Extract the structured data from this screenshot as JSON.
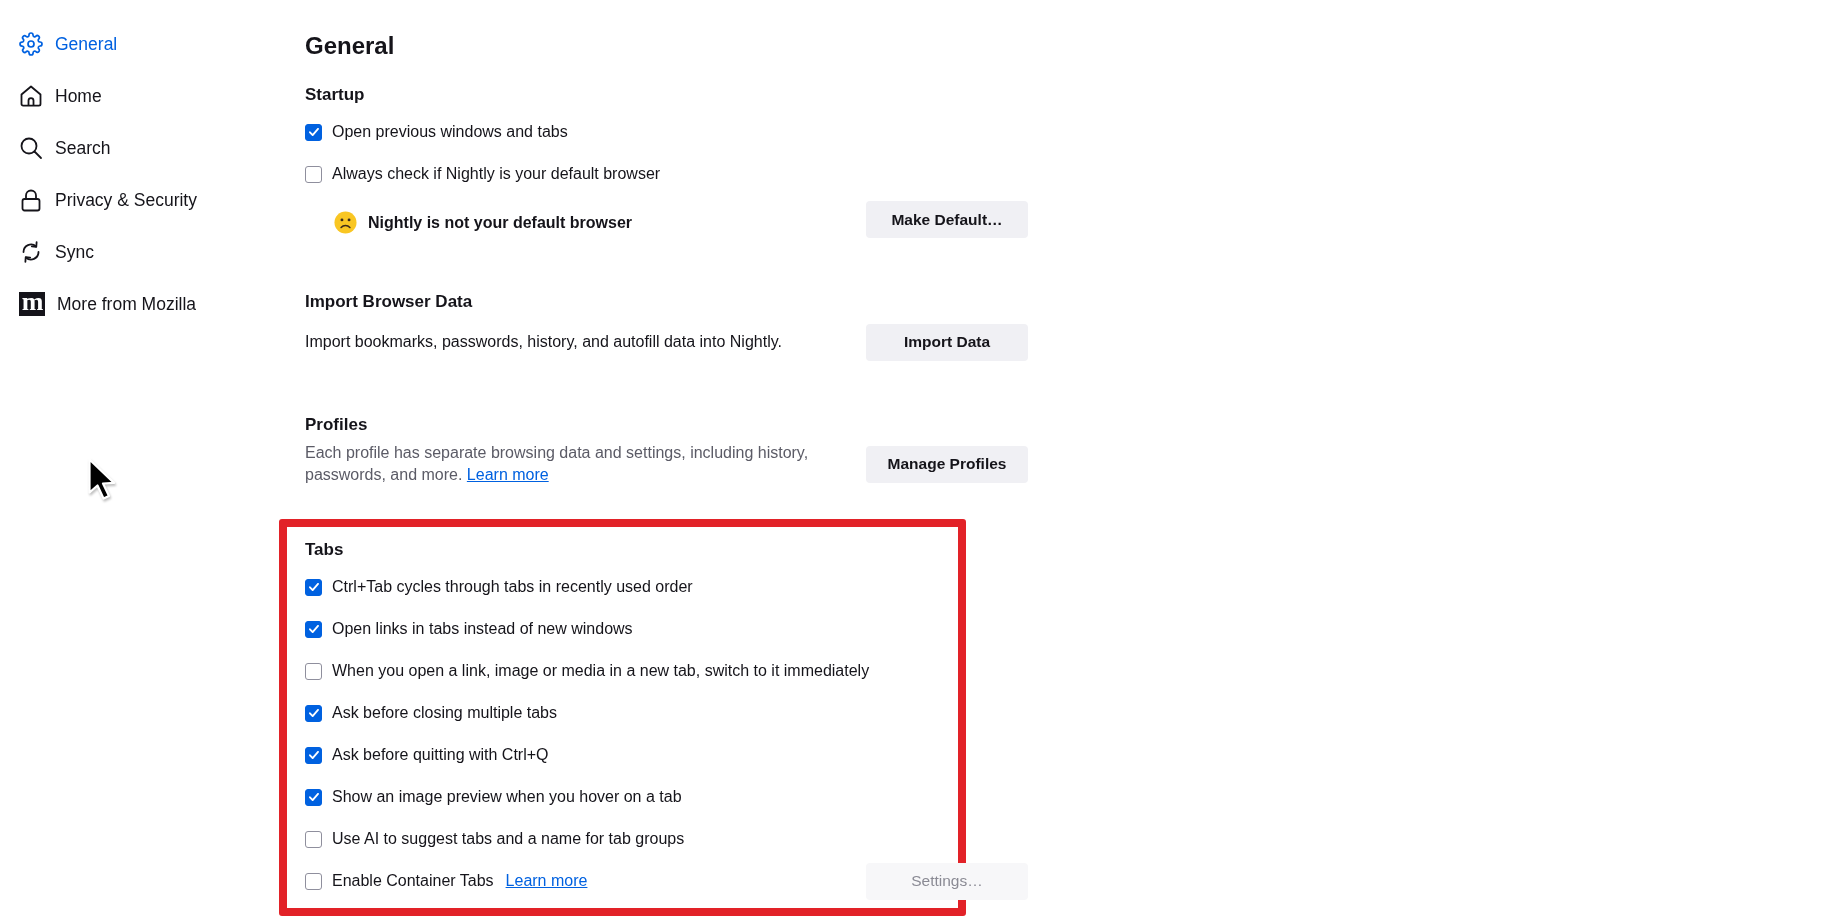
{
  "sidebar": {
    "items": [
      {
        "label": "General",
        "selected": true
      },
      {
        "label": "Home",
        "selected": false
      },
      {
        "label": "Search",
        "selected": false
      },
      {
        "label": "Privacy & Security",
        "selected": false
      },
      {
        "label": "Sync",
        "selected": false
      },
      {
        "label": "More from Mozilla",
        "selected": false,
        "logo_letter": "m"
      }
    ]
  },
  "page": {
    "title": "General"
  },
  "sections": [
    {
      "heading": "Startup",
      "highlighted": false,
      "rows": [
        {
          "kind": "checkbox",
          "label": "Open previous windows and tabs",
          "checked": true
        },
        {
          "kind": "checkbox",
          "label": "Always check if Nightly is your default browser",
          "checked": false
        },
        {
          "kind": "notice",
          "text": "Nightly is not your default browser",
          "button": {
            "label": "Make Default…",
            "disabled": false
          }
        }
      ]
    },
    {
      "heading": "Import Browser Data",
      "highlighted": false,
      "rows": [
        {
          "kind": "text",
          "text": "Import bookmarks, passwords, history, and autofill data into Nightly.",
          "button": {
            "label": "Import Data",
            "disabled": false
          }
        }
      ]
    },
    {
      "heading": "Profiles",
      "highlighted": false,
      "rows": [
        {
          "kind": "description",
          "text": "Each profile has separate browsing data and settings, including history, passwords, and more.",
          "link": "Learn more",
          "button": {
            "label": "Manage Profiles",
            "disabled": false
          }
        }
      ]
    },
    {
      "heading": "Tabs",
      "highlighted": true,
      "rows": [
        {
          "kind": "checkbox",
          "label": "Ctrl+Tab cycles through tabs in recently used order",
          "checked": true
        },
        {
          "kind": "checkbox",
          "label": "Open links in tabs instead of new windows",
          "checked": true
        },
        {
          "kind": "checkbox",
          "label": "When you open a link, image or media in a new tab, switch to it immediately",
          "checked": false
        },
        {
          "kind": "checkbox",
          "label": "Ask before closing multiple tabs",
          "checked": true
        },
        {
          "kind": "checkbox",
          "label": "Ask before quitting with Ctrl+Q",
          "checked": true
        },
        {
          "kind": "checkbox",
          "label": "Show an image preview when you hover on a tab",
          "checked": true
        },
        {
          "kind": "checkbox",
          "label": "Use AI to suggest tabs and a name for tab groups",
          "checked": false
        },
        {
          "kind": "checkbox",
          "label": "Enable Container Tabs",
          "checked": false,
          "link": "Learn more",
          "button": {
            "label": "Settings…",
            "disabled": true
          }
        }
      ]
    }
  ]
}
